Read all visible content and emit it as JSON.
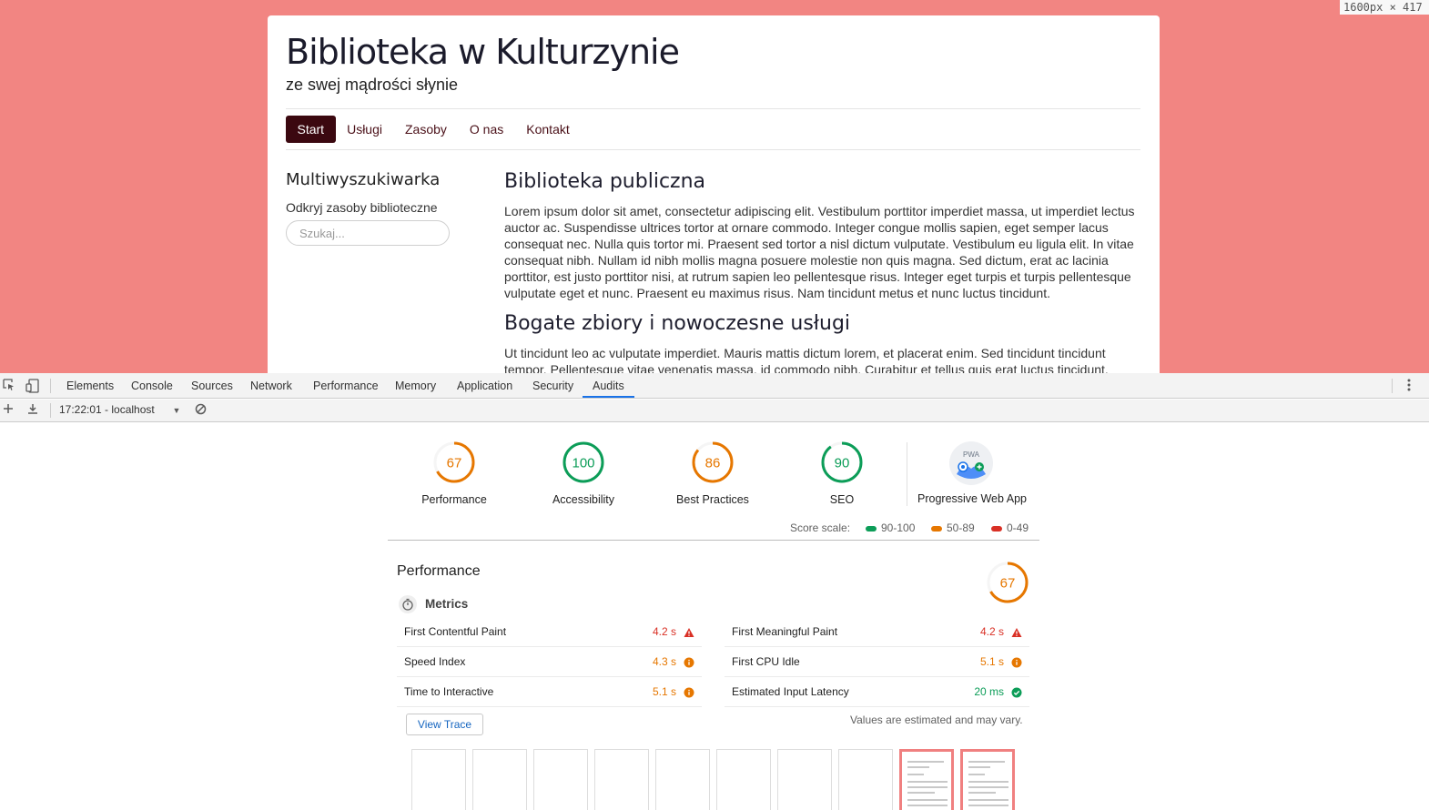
{
  "viewport": {
    "dimensions": "1600px × 417",
    "site": {
      "title": "Biblioteka w Kulturzynie",
      "subtitle": "ze swej mądrości słynie",
      "nav": [
        "Start",
        "Usługi",
        "Zasoby",
        "O nas",
        "Kontakt"
      ],
      "active_nav": "Start",
      "sidebar": {
        "heading": "Multiwyszukiwarka",
        "text": "Odkryj zasoby biblioteczne",
        "search_placeholder": "Szukaj..."
      },
      "article": {
        "heading1": "Biblioteka publiczna",
        "paragraph1": "Lorem ipsum dolor sit amet, consectetur adipiscing elit. Vestibulum porttitor imperdiet massa, ut imperdiet lectus auctor ac. Suspendisse ultrices tortor at ornare commodo. Integer congue mollis sapien, eget semper lacus consequat nec. Nulla quis tortor mi. Praesent sed tortor a nisl dictum vulputate. Vestibulum eu ligula elit. In vitae consequat nibh. Nullam id nibh mollis magna posuere molestie non quis magna. Sed dictum, erat ac lacinia porttitor, est justo porttitor nisi, at rutrum sapien leo pellentesque risus. Integer eget turpis et turpis pellentesque vulputate eget et nunc. Praesent eu maximus risus. Nam tincidunt metus et nunc luctus tincidunt.",
        "heading2": "Bogate zbiory i nowoczesne usługi",
        "paragraph2": "Ut tincidunt leo ac vulputate imperdiet. Mauris mattis dictum lorem, et placerat enim. Sed tincidunt tincidunt tempor. Pellentesque vitae venenatis massa, id commodo nibh. Curabitur et tellus quis erat luctus tincidunt. Curabitur sit amet"
      }
    }
  },
  "devtools": {
    "tabs": [
      "Elements",
      "Console",
      "Sources",
      "Network",
      "Performance",
      "Memory",
      "Application",
      "Security",
      "Audits"
    ],
    "active_tab": "Audits",
    "report_select": "17:22:01 - localhost",
    "colors": {
      "pass": "#0c9d58",
      "average": "#e67700",
      "fail": "#d93025",
      "accent": "#1a73e8"
    }
  },
  "report": {
    "categories": [
      {
        "label": "Performance",
        "score": 67,
        "rating": "average"
      },
      {
        "label": "Accessibility",
        "score": 100,
        "rating": "pass"
      },
      {
        "label": "Best Practices",
        "score": 86,
        "rating": "average"
      },
      {
        "label": "SEO",
        "score": 90,
        "rating": "pass"
      }
    ],
    "pwa": {
      "label": "Progressive Web App",
      "badge_text": "PWA",
      "icon": "pwa-badge-icon"
    },
    "score_scale": {
      "label": "Score scale:",
      "ranges": [
        {
          "label": "90-100",
          "color": "#0c9d58"
        },
        {
          "label": "50-89",
          "color": "#e67700"
        },
        {
          "label": "0-49",
          "color": "#d93025"
        }
      ]
    },
    "performance": {
      "title": "Performance",
      "score": 67,
      "metrics_title": "Metrics",
      "metrics_left": [
        {
          "name": "First Contentful Paint",
          "value": "4.2 s",
          "rating": "fail"
        },
        {
          "name": "Speed Index",
          "value": "4.3 s",
          "rating": "average"
        },
        {
          "name": "Time to Interactive",
          "value": "5.1 s",
          "rating": "average"
        }
      ],
      "metrics_right": [
        {
          "name": "First Meaningful Paint",
          "value": "4.2 s",
          "rating": "fail"
        },
        {
          "name": "First CPU Idle",
          "value": "5.1 s",
          "rating": "average"
        },
        {
          "name": "Estimated Input Latency",
          "value": "20 ms",
          "rating": "pass"
        }
      ],
      "view_trace_label": "View Trace",
      "estimate_note": "Values are estimated and may vary.",
      "filmstrip_loaded": [
        false,
        false,
        false,
        false,
        false,
        false,
        false,
        false,
        true,
        true
      ]
    }
  }
}
